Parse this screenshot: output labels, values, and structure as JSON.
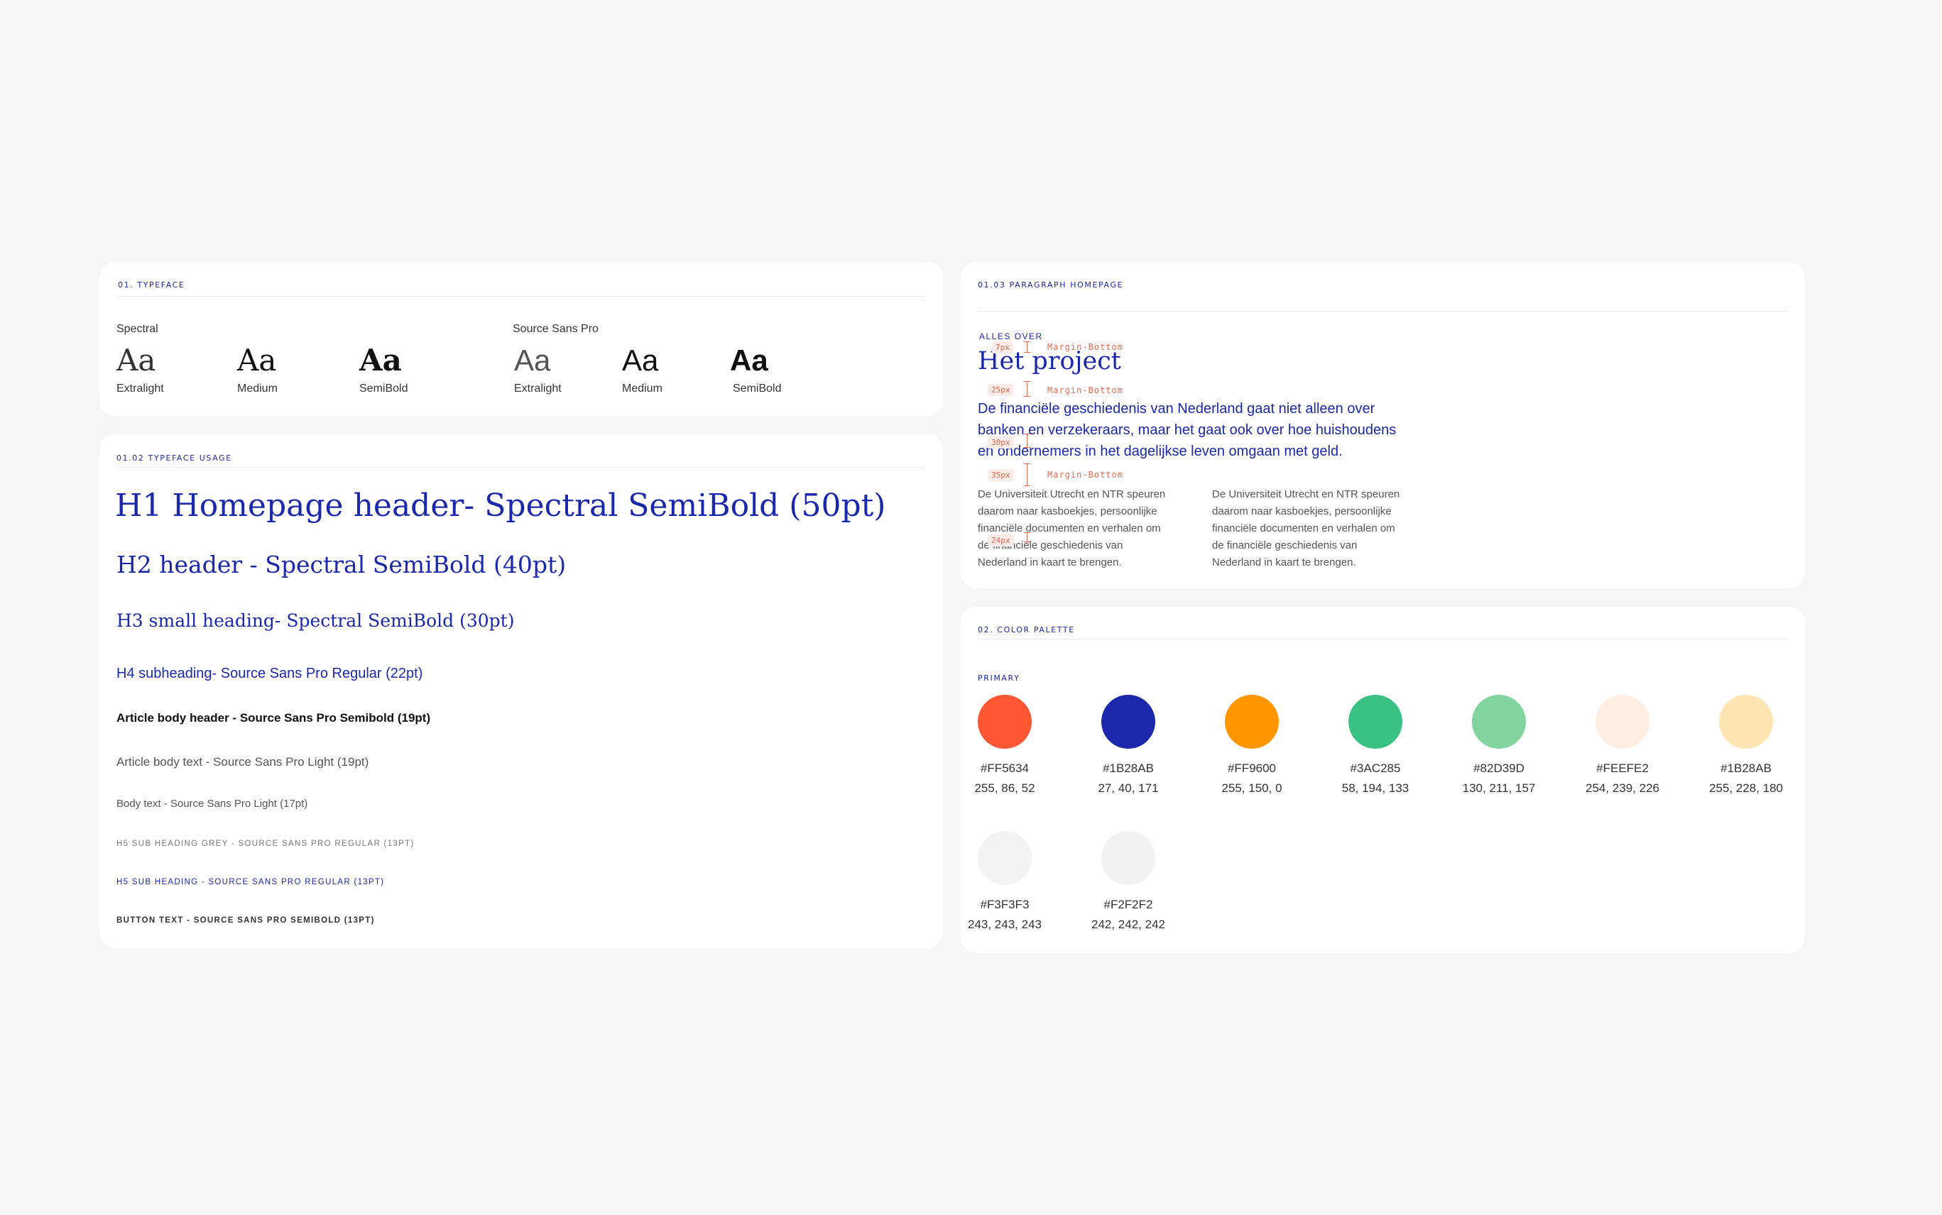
{
  "typeface": {
    "section_label": "01. TYPEFACE",
    "families": [
      {
        "name": "Spectral",
        "samples": [
          {
            "glyph": "Aa",
            "weight": "Extralight"
          },
          {
            "glyph": "Aa",
            "weight": "Medium"
          },
          {
            "glyph": "Aa",
            "weight": "SemiBold"
          }
        ]
      },
      {
        "name": "Source Sans Pro",
        "samples": [
          {
            "glyph": "Aa",
            "weight": "Extralight"
          },
          {
            "glyph": "Aa",
            "weight": "Medium"
          },
          {
            "glyph": "Aa",
            "weight": "SemiBold"
          }
        ]
      }
    ]
  },
  "usage": {
    "section_label": "01.02 TYPEFACE USAGE",
    "h1": "H1 Homepage header- Spectral SemiBold (50pt)",
    "h2": "H2 header - Spectral SemiBold (40pt)",
    "h3": "H3 small heading- Spectral SemiBold (30pt)",
    "h4": "H4 subheading- Source Sans Pro Regular (22pt)",
    "article_header": "Article body header - Source Sans Pro Semibold (19pt)",
    "article_body": "Article body text - Source Sans Pro Light (19pt)",
    "body_text": "Body text - Source Sans Pro Light (17pt)",
    "h5_grey": "H5 SUB HEADING GREY - SOURCE SANS PRO REGULAR (13PT)",
    "h5": "H5 SUB HEADING - SOURCE SANS PRO REGULAR (13PT)",
    "button_text": "BUTTON TEXT - SOURCE SANS PRO SEMIBOLD (13PT)"
  },
  "paragraph": {
    "section_label": "01.03 PARAGRAPH HOMEPAGE",
    "eyebrow": "ALLES OVER",
    "title": "Het project",
    "intro_lines": [
      "De financiële geschiedenis van Nederland gaat niet alleen over",
      "banken en verzekeraars, maar het gaat ook over hoe huishoudens",
      "en ondernemers in het dagelijkse leven omgaan met geld."
    ],
    "col1_lines": [
      "De Universiteit Utrecht en NTR speuren",
      "daarom naar kasboekjes, persoonlijke",
      "financiële documenten en verhalen om",
      "de financiële geschiedenis van",
      "Nederland in kaart te brengen."
    ],
    "col2_lines": [
      "De Universiteit Utrecht en NTR speuren",
      "daarom naar kasboekjes, persoonlijke",
      "financiële documenten en verhalen om",
      "de financiële geschiedenis van",
      "Nederland in kaart te brengen."
    ],
    "spacing": [
      {
        "value": "7px",
        "label": "Margin-Bottom"
      },
      {
        "value": "25px",
        "label": "Margin-Bottom"
      },
      {
        "value": "30px",
        "label": ""
      },
      {
        "value": "35px",
        "label": "Margin-Bottom"
      },
      {
        "value": "24px",
        "label": ""
      }
    ]
  },
  "palette": {
    "section_label": "02. COLOR PALETTE",
    "group_label": "PRIMARY",
    "colors": [
      {
        "hex": "#FF5634",
        "rgb": "255, 86, 52",
        "fill": "#FF5634"
      },
      {
        "hex": "#1B28AB",
        "rgb": "27, 40, 171",
        "fill": "#1B28AB"
      },
      {
        "hex": "#FF9600",
        "rgb": "255, 150, 0",
        "fill": "#FF9600"
      },
      {
        "hex": "#3AC285",
        "rgb": "58, 194, 133",
        "fill": "#3AC285"
      },
      {
        "hex": "#82D39D",
        "rgb": "130, 211, 157",
        "fill": "#82D39D"
      },
      {
        "hex": "#FEEFE2",
        "rgb": "254, 239, 226",
        "fill": "#FEEFE2"
      },
      {
        "hex": "#1B28AB",
        "rgb": "255, 228, 180",
        "fill": "#FFE4B4"
      },
      {
        "hex": "#F3F3F3",
        "rgb": "243, 243, 243",
        "fill": "#F3F3F3"
      },
      {
        "hex": "#F2F2F2",
        "rgb": "242, 242, 242",
        "fill": "#F2F2F2"
      }
    ]
  }
}
